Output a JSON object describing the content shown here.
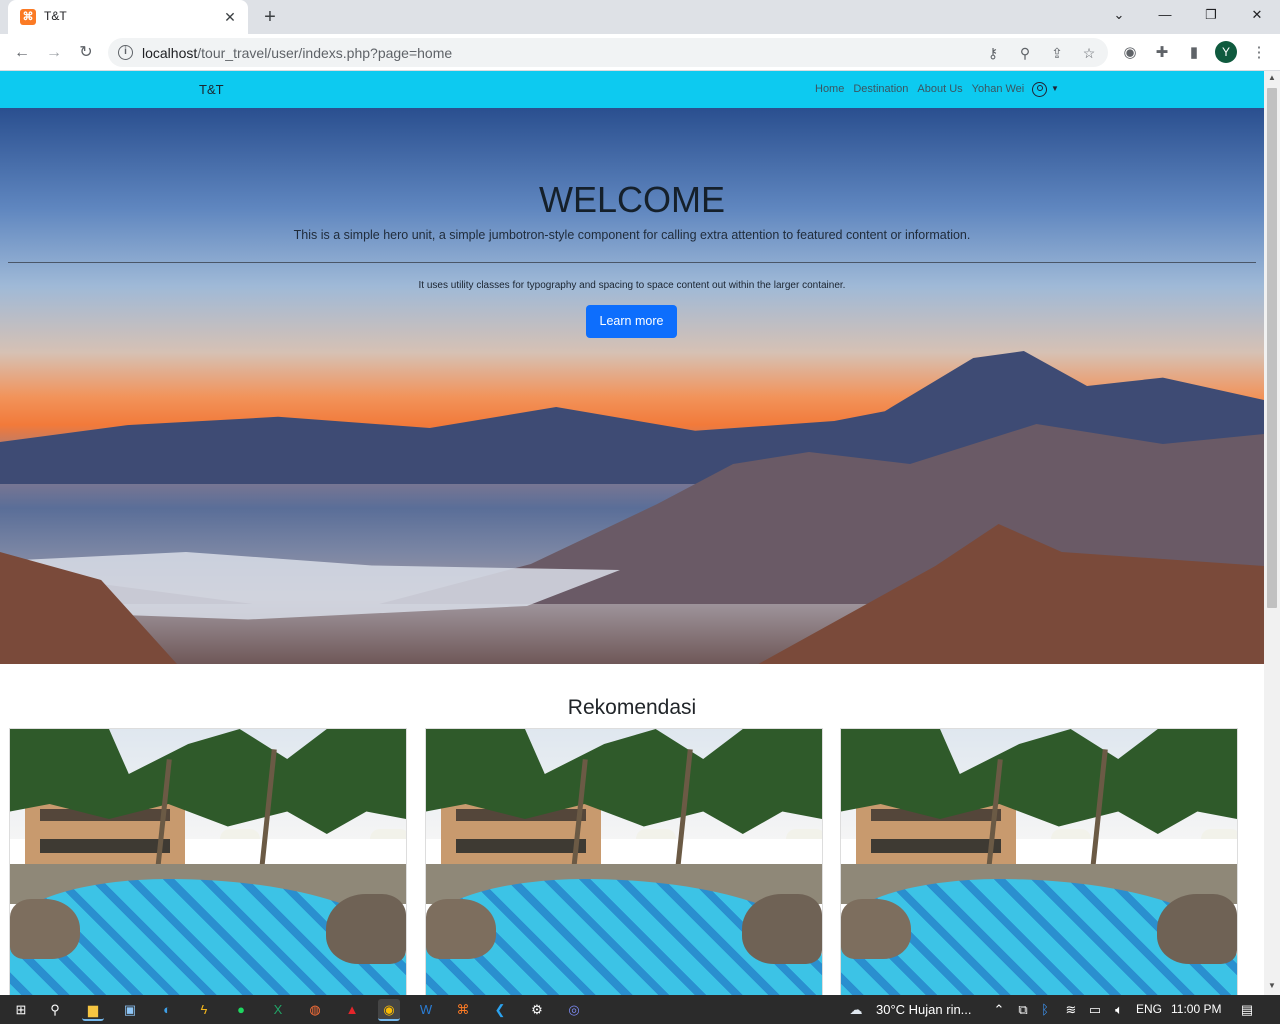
{
  "browser": {
    "tab_title": "T&T",
    "url_host": "localhost",
    "url_path": "/tour_travel/user/indexs.php?page=home",
    "profile_initial": "Y"
  },
  "site": {
    "brand": "T&T",
    "nav": [
      "Home",
      "Destination",
      "About Us",
      "Yohan Wei"
    ]
  },
  "hero": {
    "title": "WELCOME",
    "lead": "This is a simple hero unit, a simple jumbotron-style component for calling extra attention to featured content or information.",
    "text": "It uses utility classes for typography and spacing to space content out within the larger container.",
    "button": "Learn more"
  },
  "recommend": {
    "title": "Rekomendasi",
    "prev_glyph": "‹"
  },
  "taskbar": {
    "weather": "30°C  Hujan rin...",
    "lang": "ENG",
    "time": "11:00 PM"
  }
}
